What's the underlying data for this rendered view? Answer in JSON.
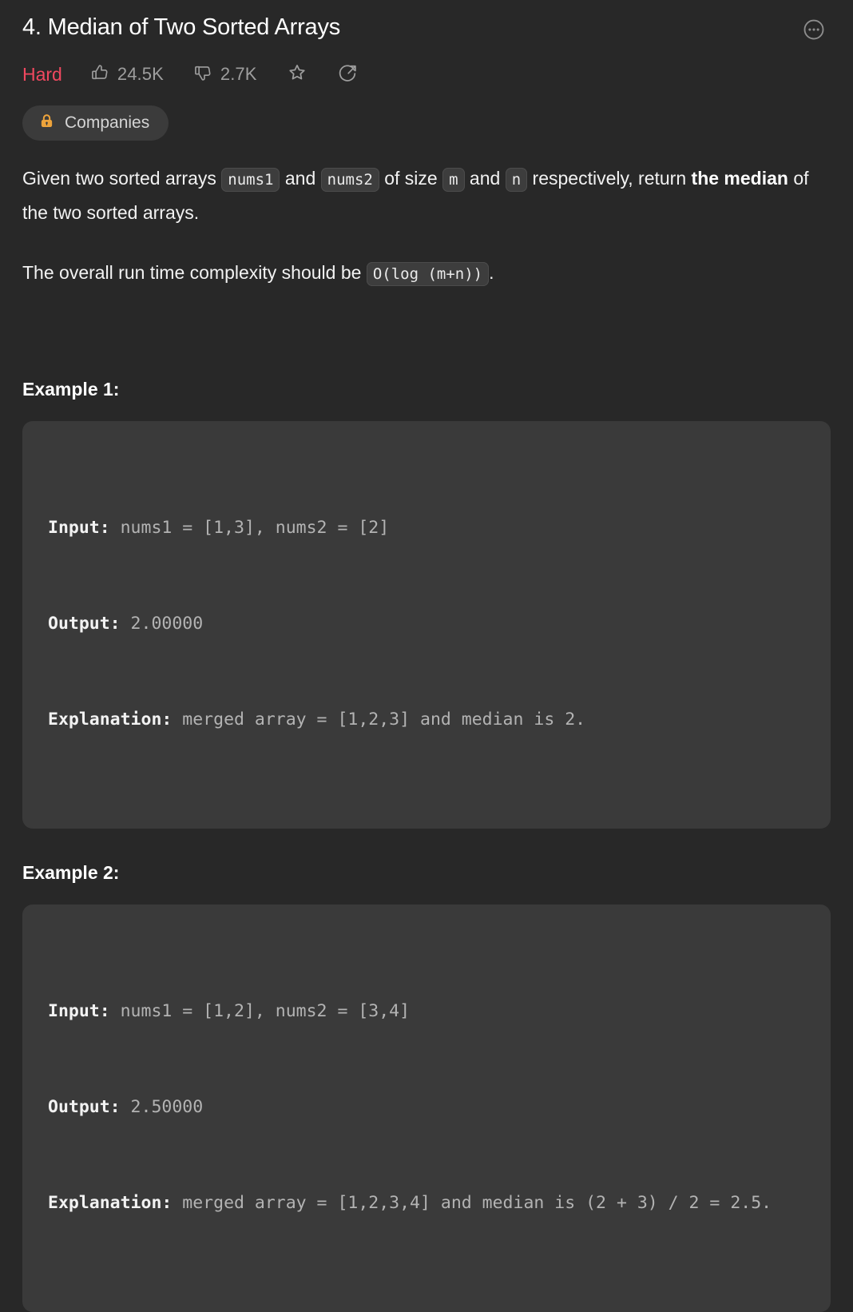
{
  "header": {
    "title": "4. Median of Two Sorted Arrays",
    "more_icon": "ellipsis-circle-icon",
    "more_label": "More options"
  },
  "meta": {
    "difficulty": "Hard",
    "difficulty_color": "#f0485f",
    "likes": "24.5K",
    "dislikes": "2.7K",
    "like_icon": "thumbs-up-icon",
    "dislike_icon": "thumbs-down-icon",
    "favorite_icon": "star-icon",
    "share_icon": "share-circle-icon"
  },
  "tags": {
    "companies_label": "Companies",
    "companies_icon": "lock-icon",
    "lock_color": "#eda33b",
    "pill_bg": "#3b3b3b"
  },
  "description": {
    "para1": {
      "t1": "Given two sorted arrays ",
      "code1": "nums1",
      "t2": " and ",
      "code2": "nums2",
      "t3": " of size ",
      "code3": "m",
      "t4": " and ",
      "code4": "n",
      "t5": " respectively, return ",
      "bold1": "the median",
      "t6": " of the two sorted arrays."
    },
    "para2": {
      "t1": "The overall run time complexity should be ",
      "code1": "O(log (m+n))",
      "t2": "."
    }
  },
  "examples": [
    {
      "heading": "Example 1:",
      "lines": [
        {
          "label": "Input:",
          "value": " nums1 = [1,3], nums2 = [2]"
        },
        {
          "label": "Output:",
          "value": " 2.00000"
        },
        {
          "label": "Explanation:",
          "value": " merged array = [1,2,3] and median is 2."
        }
      ]
    },
    {
      "heading": "Example 2:",
      "lines": [
        {
          "label": "Input:",
          "value": " nums1 = [1,2], nums2 = [3,4]"
        },
        {
          "label": "Output:",
          "value": " 2.50000"
        },
        {
          "label": "Explanation:",
          "value": " merged array = [1,2,3,4] and median is (2 + 3) / 2 = 2.5."
        }
      ]
    }
  ],
  "theme": {
    "page_bg": "#282828",
    "code_bg": "#3a3a3a",
    "text": "#f2f2f2",
    "muted": "#9e9e9e"
  }
}
